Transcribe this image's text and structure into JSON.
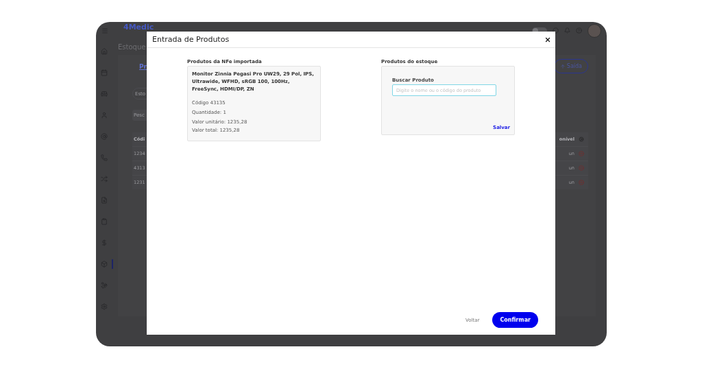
{
  "app": {
    "logo": "4Medic",
    "page_title": "Estoque",
    "link": "Pr",
    "search_placeholder": "Esto",
    "filter": "Pesc",
    "exit_button": "Saída",
    "toggle": {
      "on": false
    },
    "sidebar": {
      "items": [
        {
          "selected": false
        },
        {
          "selected": false
        },
        {
          "selected": false
        },
        {
          "selected": false
        },
        {
          "selected": false
        },
        {
          "selected": false
        },
        {
          "selected": false
        },
        {
          "selected": false
        },
        {
          "selected": false
        },
        {
          "selected": false
        },
        {
          "selected": true
        },
        {
          "selected": false
        },
        {
          "selected": false
        }
      ]
    },
    "table": {
      "columns": [
        "Códi",
        "onível"
      ],
      "rows": [
        {
          "code": "1234",
          "stock": "un"
        },
        {
          "code": "4313",
          "stock": "un"
        },
        {
          "code": "1231",
          "stock": "un"
        }
      ]
    }
  },
  "modal": {
    "title": "Entrada de Produtos",
    "nfe": {
      "label": "Produtos da NFe importada",
      "name": "Monitor Zinnia Pegasi Pro UW29, 29 Pol, IPS, Ultrawide, WFHD, sRGB 100, 100Hz, FreeSync, HDMI/DP, ZN",
      "code": "Código 43135",
      "quantity": "Quantidade: 1",
      "unit_value": "Valor unitário: 1235,28",
      "total_value": "Valor total: 1235,28"
    },
    "stock": {
      "label": "Produtos do estoque",
      "field_label": "Buscar Produto",
      "placeholder": "Digite o nome ou o código do produto",
      "save": "Salvar"
    },
    "buttons": {
      "back": "Voltar",
      "confirm": "Confirmar"
    }
  }
}
